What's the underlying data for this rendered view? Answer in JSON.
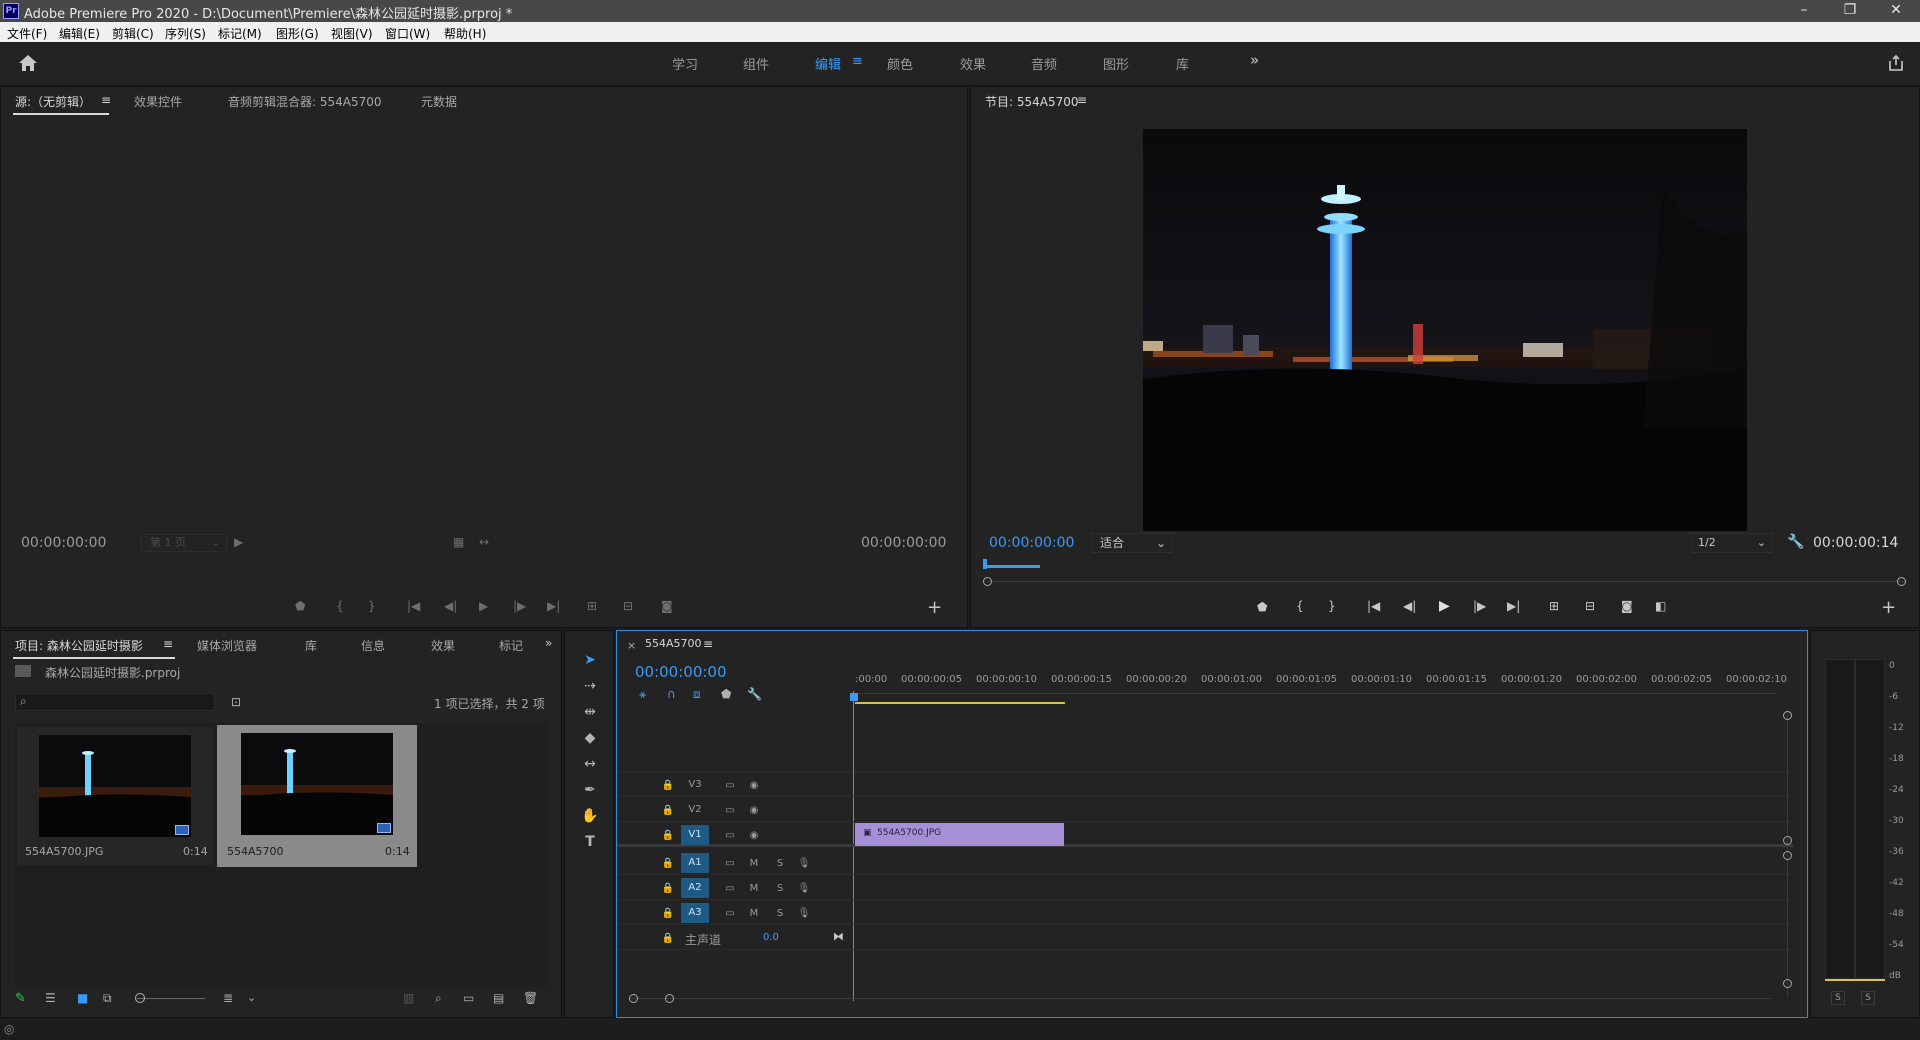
{
  "app": {
    "title": "Adobe Premiere Pro 2020 - D:\\Document\\Premiere\\森林公园延时摄影.prproj *",
    "logo": "Pr"
  },
  "window_controls": {
    "minimize": "–",
    "restore": "❐",
    "close": "✕"
  },
  "menu": [
    "文件(F)",
    "编辑(E)",
    "剪辑(C)",
    "序列(S)",
    "标记(M)",
    "图形(G)",
    "视图(V)",
    "窗口(W)",
    "帮助(H)"
  ],
  "workspaces": [
    "学习",
    "组件",
    "编辑",
    "颜色",
    "效果",
    "音频",
    "图形",
    "库"
  ],
  "workspace_active": "编辑",
  "workspace_more": "»",
  "source_panel": {
    "tabs": [
      "源:（无剪辑）",
      "效果控件",
      "音频剪辑混合器: 554A5700",
      "元数据"
    ],
    "timecode_left": "00:00:00:00",
    "page_select": "第 1 页",
    "timecode_right": "00:00:00:00"
  },
  "program_panel": {
    "title": "节目: 554A5700",
    "timecode": "00:00:00:00",
    "fit_label": "适合",
    "resolution": "1/2",
    "duration": "00:00:00:14"
  },
  "project_panel": {
    "tabs": [
      "项目: 森林公园延时摄影",
      "媒体浏览器",
      "库",
      "信息",
      "效果",
      "标记"
    ],
    "file_name": "森林公园延时摄影.prproj",
    "selection_info": "1 项已选择，共 2 项",
    "items": [
      {
        "name": "554A5700.JPG",
        "duration": "0:14"
      },
      {
        "name": "554A5700",
        "duration": "0:14"
      }
    ]
  },
  "timeline": {
    "sequence_tab": "554A5700",
    "timecode": "00:00:00:00",
    "ruler": [
      ":00:00",
      "00:00:00:05",
      "00:00:00:10",
      "00:00:00:15",
      "00:00:00:20",
      "00:00:01:00",
      "00:00:01:05",
      "00:00:01:10",
      "00:00:01:15",
      "00:00:01:20",
      "00:00:02:00",
      "00:00:02:05",
      "00:00:02:10"
    ],
    "video_tracks": [
      "V3",
      "V2",
      "V1"
    ],
    "audio_tracks": [
      "A1",
      "A2",
      "A3"
    ],
    "master_label": "主声道",
    "master_value": "0.0",
    "clip_label": "554A5700.JPG",
    "mute": "M",
    "solo": "S"
  },
  "audio_meter": {
    "scale": [
      "0",
      "-6",
      "-12",
      "-18",
      "-24",
      "-30",
      "-36",
      "-42",
      "-48",
      "-54",
      "dB"
    ],
    "solo_buttons": [
      "S",
      "S"
    ]
  },
  "colors": {
    "accent_blue": "#3b9af6",
    "clip_purple": "#a590d8",
    "panel_bg": "#232323",
    "focus_border": "#2d8ceb",
    "work_area": "#d4c24a"
  }
}
